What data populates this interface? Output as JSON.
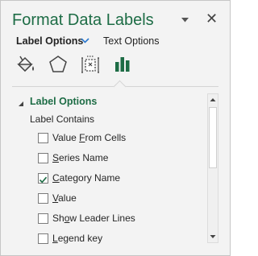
{
  "pane": {
    "title": "Format Data Labels",
    "title_dropdown_icon": "chevron-down-icon",
    "close_icon": "close-icon",
    "close_glyph": "✕"
  },
  "tabs": [
    {
      "label": "Label Options",
      "active": true
    },
    {
      "label": "Text Options",
      "active": false
    }
  ],
  "icon_row": [
    {
      "name": "fill-line-icon",
      "active": false
    },
    {
      "name": "effects-icon",
      "active": false
    },
    {
      "name": "size-properties-icon",
      "active": false
    },
    {
      "name": "label-options-icon",
      "active": true
    }
  ],
  "section": {
    "title": "Label Options",
    "expanded": true,
    "subheading": "Label Contains"
  },
  "checkboxes": [
    {
      "pre": "Value ",
      "mnemonic": "F",
      "post": "rom Cells",
      "checked": false
    },
    {
      "pre": "",
      "mnemonic": "S",
      "post": "eries Name",
      "checked": false
    },
    {
      "pre": "",
      "mnemonic": "C",
      "post": "ategory Name",
      "checked": true
    },
    {
      "pre": "",
      "mnemonic": "V",
      "post": "alue",
      "checked": false
    },
    {
      "pre": "Sh",
      "mnemonic": "o",
      "post": "w Leader Lines",
      "checked": false
    },
    {
      "pre": "",
      "mnemonic": "L",
      "post": "egend key",
      "checked": false
    }
  ],
  "colors": {
    "accent_green": "#1d6c45",
    "tab_chevron_blue": "#2b79d0",
    "pane_background": "#f3f3f3"
  }
}
